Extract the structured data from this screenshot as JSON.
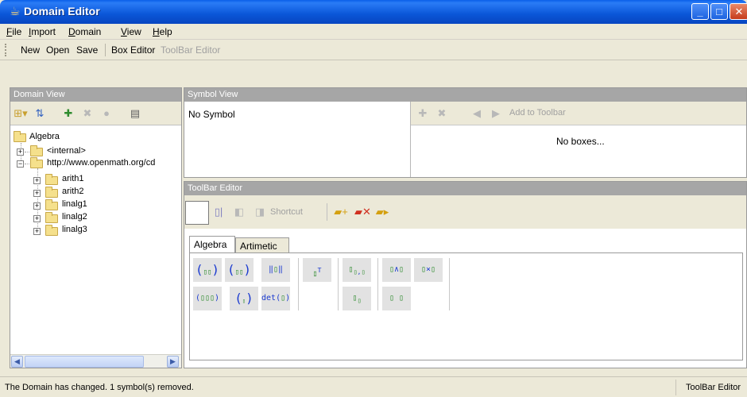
{
  "window": {
    "title": "Domain Editor"
  },
  "menu": {
    "items": [
      {
        "label": "File",
        "u": "F",
        "rest": "ile"
      },
      {
        "label": "Import",
        "u": "I",
        "rest": "mport"
      },
      {
        "label": "Domain",
        "u": "D",
        "rest": "omain"
      },
      {
        "label": "View",
        "u": "V",
        "rest": "iew"
      },
      {
        "label": "Help",
        "u": "H",
        "rest": "elp"
      }
    ]
  },
  "toolbar": {
    "new": "New",
    "open": "Open",
    "save": "Save",
    "box_editor": "Box Editor",
    "toolbar_editor": "ToolBar Editor"
  },
  "domain_view": {
    "title": "Domain View",
    "tree": {
      "root": "Algebra",
      "internal": "<internal>",
      "cd": "http://www.openmath.org/cd",
      "children": [
        "arith1",
        "arith2",
        "linalg1",
        "linalg2",
        "linalg3"
      ]
    }
  },
  "symbol_view": {
    "title": "Symbol View",
    "no_symbol": "No Symbol",
    "add_to_toolbar": "Add to Toolbar",
    "no_boxes": "No boxes..."
  },
  "toolbar_editor": {
    "title": "ToolBar Editor",
    "shortcut": "Shortcut",
    "tabs": [
      "Algebra",
      "Artimetic"
    ],
    "tiles": {
      "transpose": "T",
      "det": "det"
    }
  },
  "icons": {
    "app": "coffee-cup-icon"
  },
  "status": {
    "message": "The Domain has changed.  1 symbol(s) removed.",
    "mode": "ToolBar Editor"
  }
}
